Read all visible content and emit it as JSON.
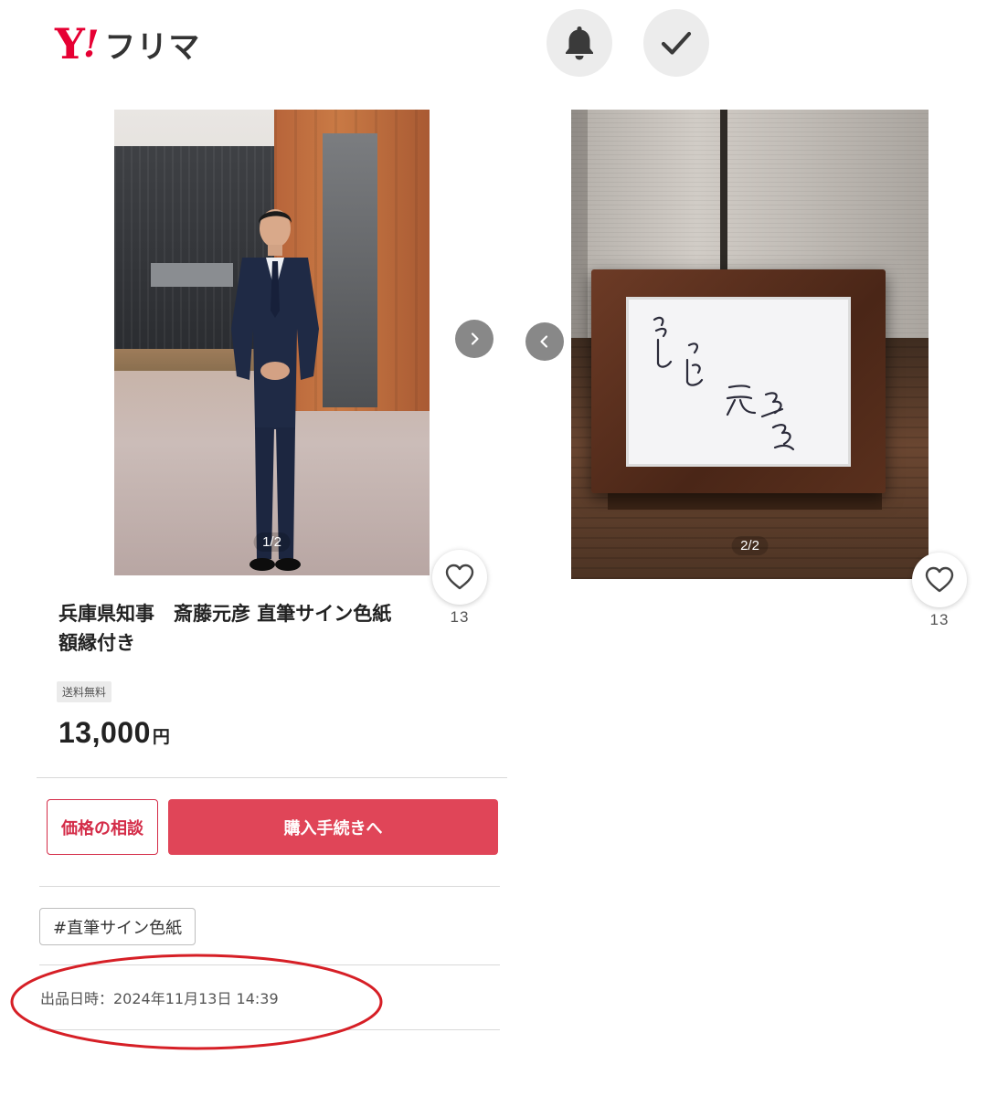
{
  "header": {
    "logo": {
      "y_mark": "Y",
      "ex_mark": "!",
      "text": "フリマ"
    },
    "icons": [
      "bell-icon",
      "check-icon"
    ]
  },
  "gallery": {
    "photo1": {
      "counter": "1/2"
    },
    "photo2": {
      "counter": "2/2"
    }
  },
  "likes": {
    "count_left": "13",
    "count_right": "13"
  },
  "item": {
    "title": "兵庫県知事　斎藤元彦 直筆サイン色紙　額縁付き",
    "shipping_badge": "送料無料",
    "price": "13,000",
    "price_unit": "円"
  },
  "actions": {
    "offer_label": "価格の相談",
    "buy_label": "購入手続きへ"
  },
  "tags": [
    "#直筆サイン色紙"
  ],
  "listing": {
    "date_label": "出品日時：2024年11月13日 14:39"
  },
  "colors": {
    "brand_red": "#e60033",
    "button_red": "#e04558",
    "annotation_red": "#d61f26"
  }
}
